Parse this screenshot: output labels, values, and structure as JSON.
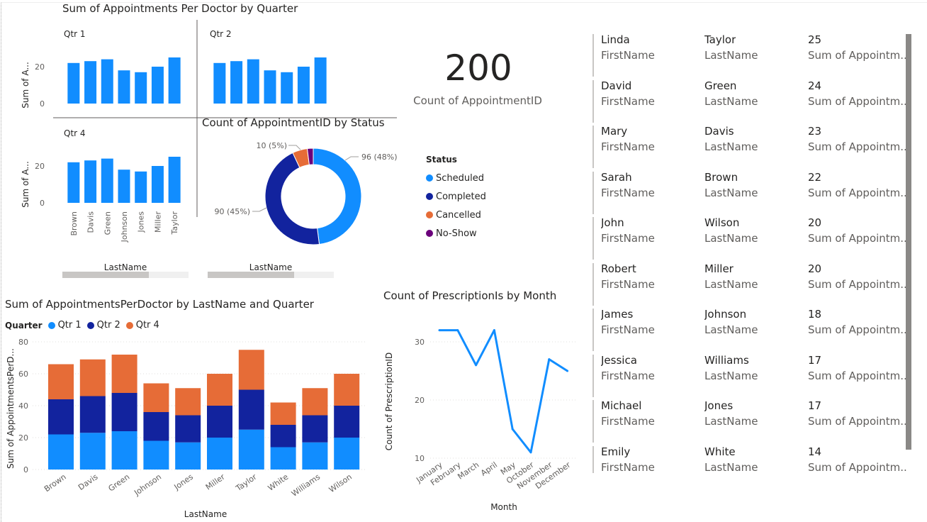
{
  "small_multiples": {
    "title": "Sum of Appointments Per Doctor by Quarter",
    "ylabel": "Sum of A...",
    "xlabel": "LastName",
    "panels": [
      {
        "label": "Qtr 1"
      },
      {
        "label": "Qtr 2"
      },
      {
        "label": "Qtr 4"
      }
    ]
  },
  "donut": {
    "title": "Count of AppointmentID by Status",
    "labels": {
      "scheduled": "96 (48%)",
      "completed": "90 (45%)",
      "cancelled": "10 (5%)"
    },
    "xlabel": "LastName"
  },
  "card": {
    "value": "200",
    "label": "Count of AppointmentID"
  },
  "status_legend": {
    "title": "Status",
    "items": [
      {
        "label": "Scheduled",
        "color": "#118dff"
      },
      {
        "label": "Completed",
        "color": "#12239e"
      },
      {
        "label": "Cancelled",
        "color": "#e66c37"
      },
      {
        "label": "No-Show",
        "color": "#6b007b"
      }
    ]
  },
  "stacked": {
    "title": "Sum of AppointmentsPerDoctor by LastName and Quarter",
    "legend_title": "Quarter",
    "legend": [
      {
        "label": "Qtr 1",
        "color": "#118dff"
      },
      {
        "label": "Qtr 2",
        "color": "#12239e"
      },
      {
        "label": "Qtr 4",
        "color": "#e66c37"
      }
    ],
    "ylabel": "Sum of AppointmentsPerD...",
    "xlabel": "LastName"
  },
  "line": {
    "title": "Count of PrescriptionIs by Month",
    "ylabel": "Count of PrescriptionID",
    "xlabel": "Month"
  },
  "multirow": {
    "labels": {
      "first": "FirstName",
      "last": "LastName",
      "sum": "Sum of Appointm..."
    },
    "rows": [
      {
        "first": "Linda",
        "last": "Taylor",
        "sum": "25"
      },
      {
        "first": "David",
        "last": "Green",
        "sum": "24"
      },
      {
        "first": "Mary",
        "last": "Davis",
        "sum": "23"
      },
      {
        "first": "Sarah",
        "last": "Brown",
        "sum": "22"
      },
      {
        "first": "John",
        "last": "Wilson",
        "sum": "20"
      },
      {
        "first": "Robert",
        "last": "Miller",
        "sum": "20"
      },
      {
        "first": "James",
        "last": "Johnson",
        "sum": "18"
      },
      {
        "first": "Jessica",
        "last": "Williams",
        "sum": "17"
      },
      {
        "first": "Michael",
        "last": "Jones",
        "sum": "17"
      },
      {
        "first": "Emily",
        "last": "White",
        "sum": "14"
      }
    ]
  },
  "chart_data": [
    {
      "type": "bar",
      "title": "Sum of Appointments Per Doctor by Quarter",
      "xlabel": "LastName",
      "ylabel": "Sum of A...",
      "categories": [
        "Brown",
        "Davis",
        "Green",
        "Johnson",
        "Jones",
        "Miller",
        "Taylor"
      ],
      "series": [
        {
          "name": "Qtr 1",
          "values": [
            22,
            23,
            24,
            18,
            17,
            20,
            25
          ]
        },
        {
          "name": "Qtr 2",
          "values": [
            22,
            23,
            24,
            18,
            17,
            20,
            25
          ]
        },
        {
          "name": "Qtr 4",
          "values": [
            22,
            23,
            24,
            18,
            17,
            20,
            25
          ]
        }
      ],
      "yticks": [
        0,
        20
      ],
      "ylim": [
        0,
        30
      ],
      "color": "#118dff"
    },
    {
      "type": "pie",
      "title": "Count of AppointmentID by Status",
      "categories": [
        "Scheduled",
        "Completed",
        "Cancelled",
        "No-Show"
      ],
      "values": [
        96,
        90,
        10,
        4
      ],
      "colors": [
        "#118dff",
        "#12239e",
        "#e66c37",
        "#6b007b"
      ]
    },
    {
      "type": "bar",
      "title": "Sum of AppointmentsPerDoctor by LastName and Quarter",
      "xlabel": "LastName",
      "ylabel": "Sum of AppointmentsPerD...",
      "categories": [
        "Brown",
        "Davis",
        "Green",
        "Johnson",
        "Jones",
        "Miller",
        "Taylor",
        "White",
        "Williams",
        "Wilson"
      ],
      "series": [
        {
          "name": "Qtr 1",
          "values": [
            22,
            23,
            24,
            18,
            17,
            20,
            25,
            14,
            17,
            20
          ]
        },
        {
          "name": "Qtr 2",
          "values": [
            22,
            23,
            24,
            18,
            17,
            20,
            25,
            14,
            17,
            20
          ]
        },
        {
          "name": "Qtr 4",
          "values": [
            22,
            23,
            24,
            18,
            17,
            20,
            25,
            14,
            17,
            20
          ]
        }
      ],
      "stacked": true,
      "yticks": [
        0,
        20,
        40,
        60,
        80
      ],
      "ylim": [
        0,
        80
      ]
    },
    {
      "type": "line",
      "title": "Count of PrescriptionIs by Month",
      "xlabel": "Month",
      "ylabel": "Count of PrescriptionID",
      "categories": [
        "January",
        "February",
        "March",
        "April",
        "May",
        "October",
        "November",
        "December"
      ],
      "values": [
        32,
        32,
        26,
        32,
        15,
        11,
        27,
        25
      ],
      "yticks": [
        10,
        20,
        30
      ],
      "ylim": [
        10,
        33
      ],
      "color": "#118dff"
    }
  ]
}
